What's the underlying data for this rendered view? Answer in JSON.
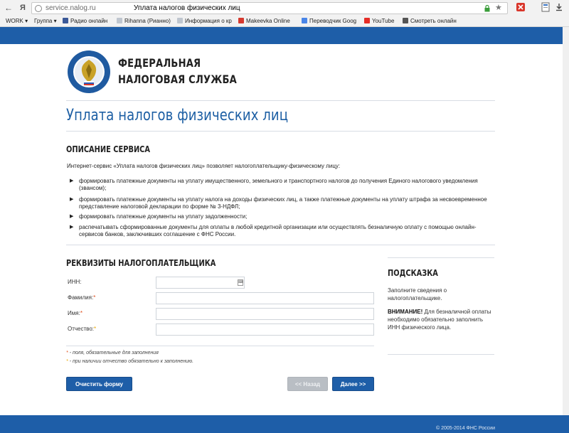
{
  "browser": {
    "back_glyph": "←",
    "ya_glyph": "Я",
    "domain": "service.nalog.ru",
    "page_title": "Уплата налогов физических лиц",
    "bookmarks": [
      {
        "label": "WORK ▾",
        "icon": "folder-icon"
      },
      {
        "label": "Группа ▾",
        "icon": "folder-icon"
      },
      {
        "label": "Радио онлайн",
        "icon": "facebook-icon"
      },
      {
        "label": "Rihanna (Рианно)",
        "icon": "page-icon"
      },
      {
        "label": "Информация о кр",
        "icon": "page-icon"
      },
      {
        "label": "Makeevka Online",
        "icon": "makeevka-icon"
      },
      {
        "label": "Переводчик Goog",
        "icon": "translate-icon"
      },
      {
        "label": "YouTube",
        "icon": "youtube-icon"
      },
      {
        "label": "Смотреть онлайн",
        "icon": "film-icon"
      }
    ]
  },
  "header": {
    "org_line1": "ФЕДЕРАЛЬНАЯ",
    "org_line2": "НАЛОГОВАЯ СЛУЖБА",
    "page_title": "Уплата налогов физических лиц"
  },
  "description": {
    "title": "ОПИСАНИЕ СЕРВИСА",
    "intro": "Интернет-сервис «Уплата налогов физических лиц» позволяет налогоплательщику-физическому лицу:",
    "bullets": [
      "формировать платежные документы на уплату имущественного, земельного и транспортного налогов до получения Единого налогового уведомления (звансом);",
      "формировать платежные документы на уплату налога на доходы физических лиц, а также платежные документы на уплату штрафа за несвоевременное представление налоговой декларации по форме № 3-НДФЛ;",
      "формировать платежные документы на уплату задолженности;",
      "распечатывать сформированные документы для оплаты в любой кредитной организации или осуществлять безналичную оплату с помощью онлайн-сервисов банков, заключивших соглашение с ФНС России."
    ]
  },
  "form": {
    "title": "РЕКВИЗИТЫ НАЛОГОПЛАТЕЛЬЩИКА",
    "inn_label": "ИНН:",
    "surname_label": "Фамилия:",
    "name_label": "Имя:",
    "patronymic_label": "Отчество:",
    "req_mark": "*",
    "inn_value": "",
    "surname_value": "",
    "name_value": "",
    "patronymic_value": "",
    "note1": "- поля, обязательные для заполнения",
    "note2": "- при наличии отчество обязательно к заполнению.",
    "clear_button": "Очистить форму",
    "back_button": "<< Назад",
    "next_button": "Далее >>"
  },
  "hint": {
    "title": "ПОДСКАЗКА",
    "text": "Заполните сведения о налогоплательщике.",
    "warning_label": "ВНИМАНИЕ!",
    "warning_text": " Для безналичной оплаты необходимо обязательно заполнить ИНН физического лица."
  },
  "footer": {
    "copyright": "© 2005-2014 ФНС России"
  },
  "colors": {
    "brand_blue": "#1e5ea8",
    "title_blue": "#1d5fa4",
    "required_red": "#e04d1a",
    "required_yellow": "#e8a700"
  }
}
